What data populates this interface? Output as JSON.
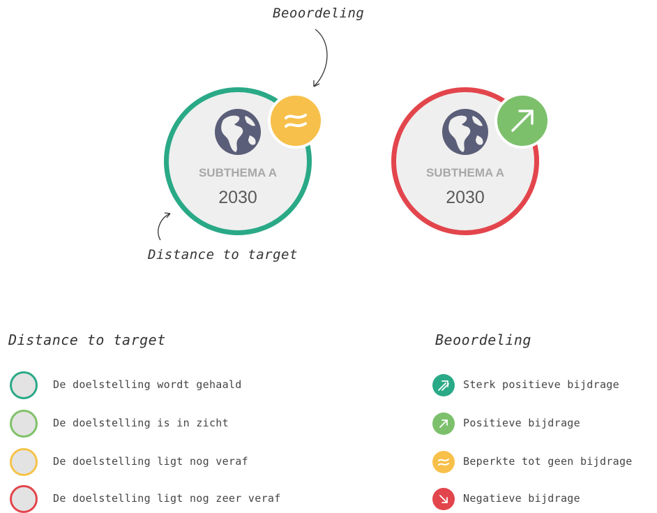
{
  "annotations": {
    "beoordeling": "Beoordeling",
    "distance_to_target": "Distance to target"
  },
  "badges": [
    {
      "label": "SUBTHEMA A",
      "year": "2030",
      "ring_color": "#2aa987",
      "mark_color": "#f7c04b",
      "mark_icon": "approx-equal-icon"
    },
    {
      "label": "SUBTHEMA A",
      "year": "2030",
      "ring_color": "#e3454c",
      "mark_color": "#7cc06c",
      "mark_icon": "arrow-up-right-icon"
    }
  ],
  "colors": {
    "badge_fill": "#efefef",
    "globe": "#5b5e78",
    "text_muted": "#a8a8a8"
  },
  "legend_distance": {
    "title": "Distance to target",
    "items": [
      {
        "label": "De doelstelling wordt gehaald",
        "color": "#2aa987"
      },
      {
        "label": "De doelstelling is in zicht",
        "color": "#80c26a"
      },
      {
        "label": "De doelstelling ligt nog veraf",
        "color": "#f5c349"
      },
      {
        "label": "De doelstelling ligt nog zeer veraf",
        "color": "#e3454c"
      }
    ]
  },
  "legend_beoordeling": {
    "title": "Beoordeling",
    "items": [
      {
        "label": "Sterk positieve bijdrage",
        "color": "#2aa987",
        "icon": "double-arrow-up-right-icon"
      },
      {
        "label": "Positieve bijdrage",
        "color": "#7cc06c",
        "icon": "arrow-up-right-icon"
      },
      {
        "label": "Beperkte tot geen bijdrage",
        "color": "#f7c04b",
        "icon": "approx-equal-icon"
      },
      {
        "label": "Negatieve bijdrage",
        "color": "#e3454c",
        "icon": "arrow-down-right-icon"
      }
    ]
  }
}
